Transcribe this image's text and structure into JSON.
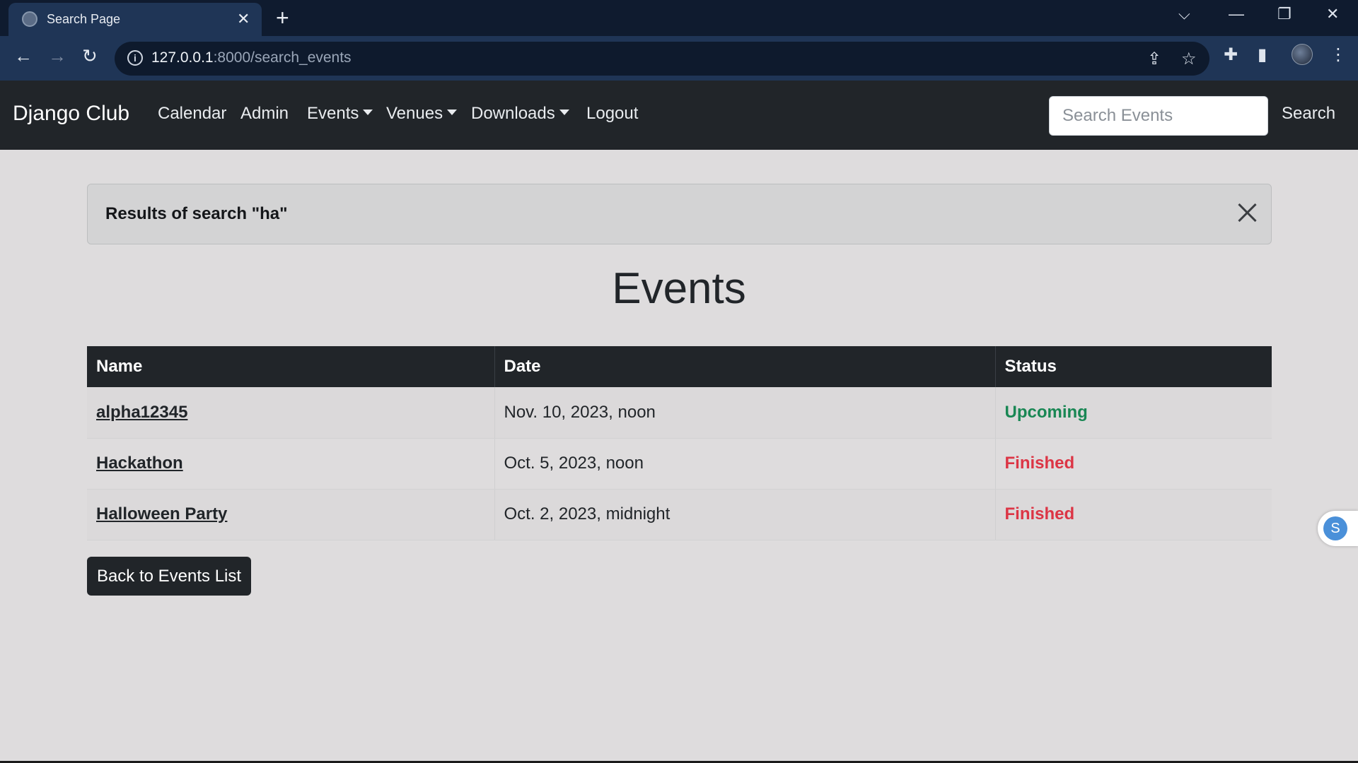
{
  "browser": {
    "tab_title": "Search Page",
    "url_host": "127.0.0.1",
    "url_path": ":8000/search_events"
  },
  "navbar": {
    "brand": "Django Club",
    "links": {
      "calendar": "Calendar",
      "admin": "Admin",
      "events": "Events",
      "venues": "Venues",
      "downloads": "Downloads",
      "logout": "Logout"
    },
    "search_placeholder": "Search Events",
    "search_label": "Search"
  },
  "alert": {
    "text": "Results of search \"ha\""
  },
  "page": {
    "title": "Events"
  },
  "table": {
    "headers": {
      "name": "Name",
      "date": "Date",
      "status": "Status"
    },
    "rows": [
      {
        "name": "alpha12345",
        "date": "Nov. 10, 2023, noon",
        "status": "Upcoming"
      },
      {
        "name": "Hackathon",
        "date": "Oct. 5, 2023, noon",
        "status": "Finished"
      },
      {
        "name": "Halloween Party",
        "date": "Oct. 2, 2023, midnight",
        "status": "Finished"
      }
    ]
  },
  "back_button": "Back to Events List",
  "side_extension": {
    "letter": "S"
  },
  "colors": {
    "navbar_bg": "#212529",
    "upcoming": "#198754",
    "finished": "#dc3545",
    "browser_frame": "#1f3556"
  }
}
